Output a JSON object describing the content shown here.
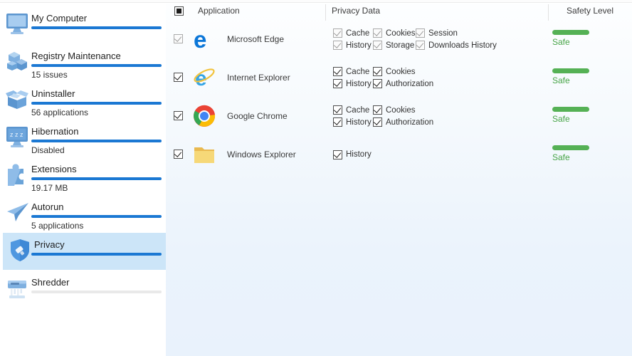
{
  "colors": {
    "accent_blue": "#1b78d3",
    "sidebar_selected_bg": "#cce5f8",
    "safe_bar_green": "#55b155",
    "safe_text_green": "#48a548",
    "underline_inactive_gray": "#e9e9e9",
    "content_bg_bottom": "#e9f2fc"
  },
  "sidebar": {
    "items": [
      {
        "label": "My Computer",
        "subtitle": "",
        "icon": "computer-icon",
        "selected": false
      },
      {
        "label": "Registry Maintenance",
        "subtitle": "15 issues",
        "icon": "registry-icon",
        "selected": false
      },
      {
        "label": "Uninstaller",
        "subtitle": "56 applications",
        "icon": "uninstaller-icon",
        "selected": false
      },
      {
        "label": "Hibernation",
        "subtitle": "Disabled",
        "icon": "hibernation-icon",
        "selected": false
      },
      {
        "label": "Extensions",
        "subtitle": "19.17 MB",
        "icon": "extensions-icon",
        "selected": false
      },
      {
        "label": "Autorun",
        "subtitle": "5 applications",
        "icon": "autorun-icon",
        "selected": false
      },
      {
        "label": "Privacy",
        "subtitle": "",
        "icon": "privacy-icon",
        "selected": true
      },
      {
        "label": "Shredder",
        "subtitle": "",
        "icon": "shredder-icon",
        "selected": false
      }
    ]
  },
  "table": {
    "columns": [
      "Application",
      "Privacy Data",
      "Safety Level"
    ],
    "select_all_state": "indeterminate",
    "rows": [
      {
        "app": "Microsoft Edge",
        "icon": "edge-icon",
        "checked": true,
        "disabled": true,
        "privacy": [
          [
            "Cache",
            "Cookies",
            "Session"
          ],
          [
            "History",
            "Storage",
            "Downloads History"
          ]
        ],
        "safety": {
          "label": "Safe",
          "level": "safe"
        }
      },
      {
        "app": "Internet Explorer",
        "icon": "internet-explorer-icon",
        "checked": true,
        "disabled": false,
        "privacy": [
          [
            "Cache",
            "Cookies"
          ],
          [
            "History",
            "Authorization"
          ]
        ],
        "safety": {
          "label": "Safe",
          "level": "safe"
        }
      },
      {
        "app": "Google Chrome",
        "icon": "chrome-icon",
        "checked": true,
        "disabled": false,
        "privacy": [
          [
            "Cache",
            "Cookies"
          ],
          [
            "History",
            "Authorization"
          ]
        ],
        "safety": {
          "label": "Safe",
          "level": "safe"
        }
      },
      {
        "app": "Windows Explorer",
        "icon": "folder-icon",
        "checked": true,
        "disabled": false,
        "privacy": [
          [
            "History"
          ]
        ],
        "safety": {
          "label": "Safe",
          "level": "safe"
        }
      }
    ]
  }
}
